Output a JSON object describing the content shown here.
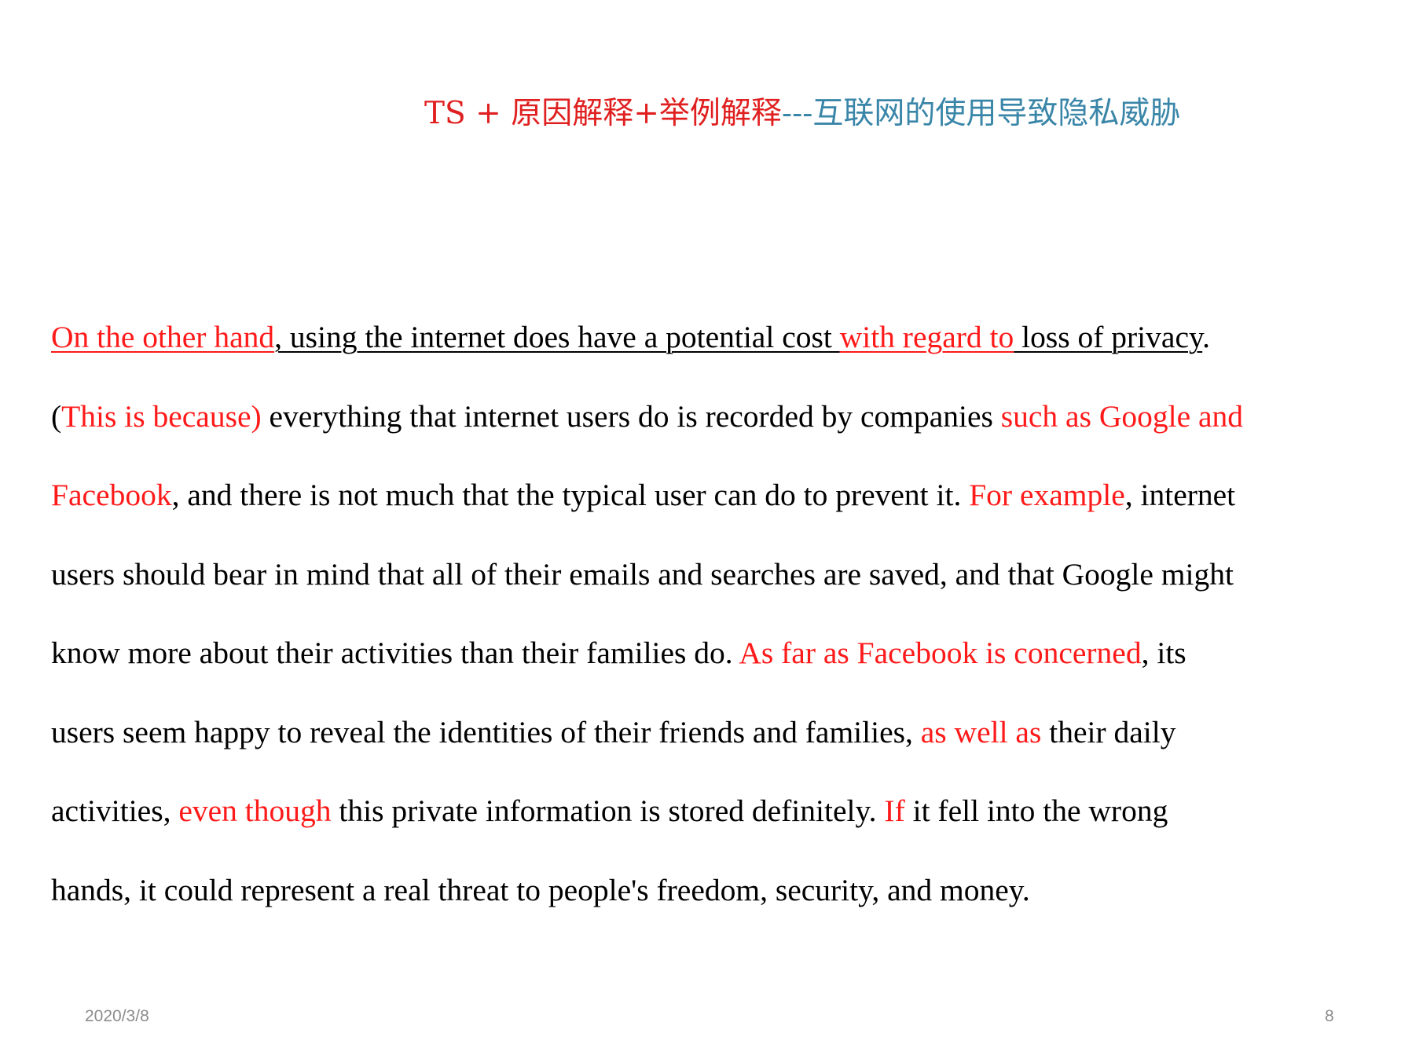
{
  "title": {
    "part_ts": "TS + ",
    "part_reason": "原因解释+举例解释",
    "part_topic": "---互联网的使用导致隐私威胁"
  },
  "paragraph": {
    "l1_a": "On the other hand",
    "l1_b": ", using the internet does have a potential cost ",
    "l1_c": "with regard to",
    "l1_d": " loss of privacy",
    "l1_e": ".",
    "l2_a": "(",
    "l2_b": "This is because)",
    "l2_c": " everything that internet users do is recorded by companies ",
    "l2_d": "such as Google and",
    "l3_a": "Facebook",
    "l3_b": ", and there is not much that the typical user can do to prevent it. ",
    "l3_c": "For example",
    "l3_d": ", internet",
    "l4_a": "users should bear in mind that all of their emails and searches are saved, and that Google might",
    "l5_a": "know more about their activities than their families do. ",
    "l5_b": "As far as Facebook is concerned",
    "l5_c": ", its",
    "l6_a": "users seem happy to reveal the identities of their friends and families, ",
    "l6_b": "as well as",
    "l6_c": " their daily",
    "l7_a": "activities, ",
    "l7_b": "even though",
    "l7_c": " this private information is stored definitely. ",
    "l7_d": "If",
    "l7_e": " it fell into the wrong",
    "l8_a": "hands, it could represent a real threat to people's freedom, security, and money."
  },
  "footer": {
    "date": "2020/3/8",
    "page_number": "8"
  },
  "colors": {
    "highlight": "#ff1a1a",
    "title_red": "#e02020",
    "title_teal": "#3a86a8",
    "footer_gray": "#8c8c8c"
  }
}
